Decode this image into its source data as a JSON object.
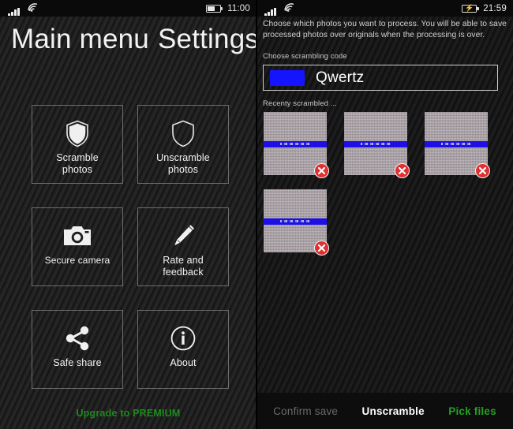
{
  "left": {
    "status": {
      "signal_icon": "signal-bars-icon",
      "wifi_icon": "wifi-icon",
      "battery_icon": "battery-icon",
      "battery_state": "discharging",
      "time": "11:00"
    },
    "title": "Main menu",
    "tiles": [
      {
        "id": "scramble-photos",
        "icon": "shield-filled-icon",
        "label": "Scramble\nphotos"
      },
      {
        "id": "unscramble-photos",
        "icon": "shield-outline-icon",
        "label": "Unscramble\nphotos"
      },
      {
        "id": "secure-camera",
        "icon": "camera-icon",
        "label": "Secure camera"
      },
      {
        "id": "rate-and-feedback",
        "icon": "pencil-icon",
        "label": "Rate and\nfeedback"
      },
      {
        "id": "safe-share",
        "icon": "share-icon",
        "label": "Safe share"
      },
      {
        "id": "about",
        "icon": "info-circle-icon",
        "label": "About"
      }
    ],
    "premium_label": "Upgrade to PREMIUM",
    "premium_color": "#1c8a1c"
  },
  "right": {
    "status": {
      "signal_icon": "signal-bars-icon",
      "wifi_icon": "wifi-icon",
      "battery_icon": "battery-charging-icon",
      "battery_state": "charging",
      "time": "21:59"
    },
    "title": "Settings",
    "intro_text": "Choose which photos you want to process. You will be able to save processed photos over originals when the processing is over.",
    "code_label": "Choose scrambling code",
    "code_value": "Qwertz",
    "code_swatch_color": "#1414ff",
    "recent_label": "Recenty scrambled ...",
    "thumbnails": [
      {
        "id": "thumb-1",
        "delete_icon": "delete-x-icon"
      },
      {
        "id": "thumb-2",
        "delete_icon": "delete-x-icon"
      },
      {
        "id": "thumb-3",
        "delete_icon": "delete-x-icon"
      },
      {
        "id": "thumb-4",
        "delete_icon": "delete-x-icon"
      }
    ],
    "appbar": {
      "confirm_save": "Confirm save",
      "confirm_save_enabled": false,
      "unscramble": "Unscramble",
      "pick_files": "Pick files",
      "pick_files_color": "#24a024"
    }
  }
}
